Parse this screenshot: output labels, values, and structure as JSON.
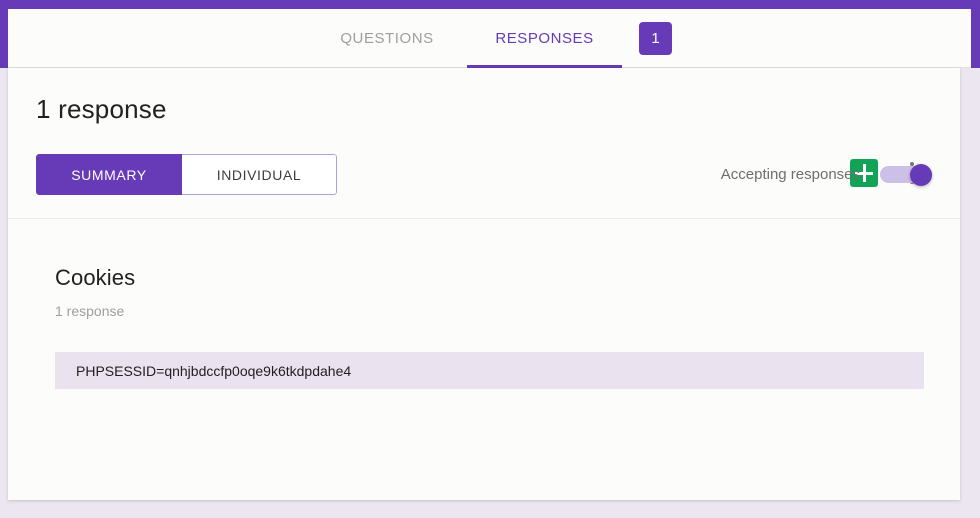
{
  "tabs": [
    {
      "id": "questions",
      "label": "QUESTIONS",
      "active": false
    },
    {
      "id": "responses",
      "label": "RESPONSES",
      "active": true
    }
  ],
  "response_badge": "1",
  "summary": {
    "total_responses_label": "1 response",
    "view_toggle": {
      "summary_label": "SUMMARY",
      "individual_label": "INDIVIDUAL",
      "selected": "SUMMARY"
    },
    "accepting_responses": {
      "label": "Accepting responses",
      "state": "on"
    },
    "icons": {
      "sheets": "google-sheets-icon",
      "overflow": "more-vert-icon"
    }
  },
  "question": {
    "title": "Cookies",
    "response_count_label": "1 response",
    "answers": [
      "PHPSESSID=qnhjbdccfp0oqe9k6tkdpdahe4"
    ]
  },
  "colors": {
    "brand_purple": "#673ab7",
    "answer_row_bg": "#eae3ef",
    "sheets_green": "#12a456",
    "page_bg": "#ece6f0"
  }
}
